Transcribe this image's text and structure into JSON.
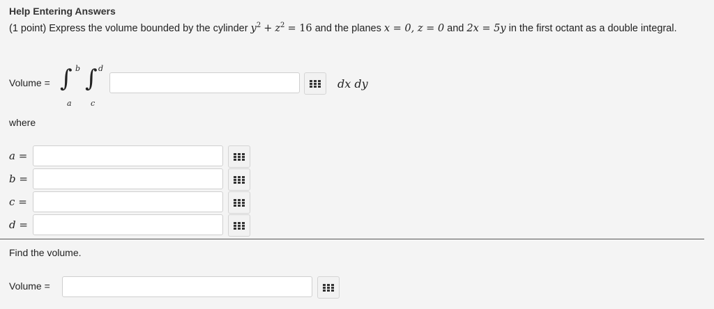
{
  "help_link": "Help Entering Answers",
  "problem": {
    "points": "(1 point)",
    "text_1": "Express the volume bounded by the cylinder",
    "y": "y",
    "exp2": "2",
    "plus": "+",
    "z": "z",
    "eq16": "= 16",
    "text_2": "and the planes",
    "x0": "x = 0, z = 0",
    "text_3": "and",
    "plane": "2x = 5y",
    "text_4": "in the first octant as a double integral."
  },
  "volume_label": "Volume =",
  "integral": {
    "upper_outer": "b",
    "lower_outer": "a",
    "upper_inner": "d",
    "lower_inner": "c",
    "sign": "∫"
  },
  "differentials": "dx dy",
  "where_label": "where",
  "vars": [
    {
      "name": "a",
      "eq": "="
    },
    {
      "name": "b",
      "eq": "="
    },
    {
      "name": "c",
      "eq": "="
    },
    {
      "name": "d",
      "eq": "="
    }
  ],
  "find_label": "Find the volume.",
  "volume2_label": "Volume ="
}
